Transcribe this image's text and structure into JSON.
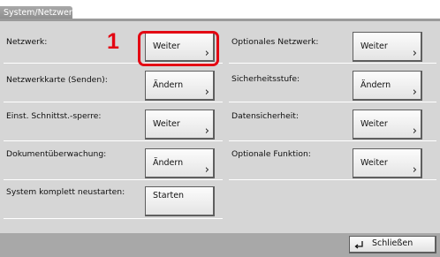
{
  "window": {
    "title": "System/Netzwerk"
  },
  "annotation": {
    "marker": "1"
  },
  "settings": {
    "left": [
      {
        "label": "Netzwerk:",
        "button": "Weiter"
      },
      {
        "label": "Netzwerkkarte (Senden):",
        "button": "Ändern"
      },
      {
        "label": "Einst. Schnittst.-sperre:",
        "button": "Weiter"
      },
      {
        "label": "Dokumentüberwachung:",
        "button": "Ändern"
      },
      {
        "label": "System komplett neustarten:",
        "button": "Starten"
      }
    ],
    "right": [
      {
        "label": "Optionales Netzwerk:",
        "button": "Weiter"
      },
      {
        "label": "Sicherheitsstufe:",
        "button": "Ändern"
      },
      {
        "label": "Datensicherheit:",
        "button": "Weiter"
      },
      {
        "label": "Optionale Funktion:",
        "button": "Weiter"
      }
    ]
  },
  "footer": {
    "close_label": "Schließen"
  },
  "icons": {
    "button_chevron": "chevron-right-icon",
    "close": "enter-arrow-icon"
  },
  "colors": {
    "highlight": "#e30613",
    "panel": "#d6d6d6",
    "footer": "#a8a8a8"
  }
}
